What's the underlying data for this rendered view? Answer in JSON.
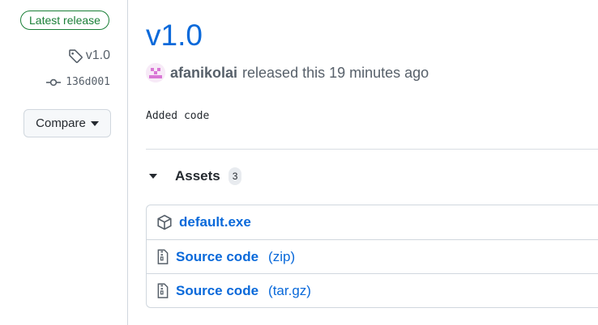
{
  "sidebar": {
    "latest_label": "Latest release",
    "tag_label": "v1.0",
    "commit_sha": "136d001",
    "compare_label": "Compare"
  },
  "release": {
    "title": "v1.0",
    "author": "afanikolai",
    "released_text": "released this 19 minutes ago",
    "notes": "Added code"
  },
  "assets": {
    "title": "Assets",
    "count": "3",
    "items": [
      {
        "name": "default.exe",
        "ext": "",
        "icon": "package-icon"
      },
      {
        "name": "Source code",
        "ext": "(zip)",
        "icon": "file-zip-icon"
      },
      {
        "name": "Source code",
        "ext": "(tar.gz)",
        "icon": "file-zip-icon"
      }
    ]
  },
  "colors": {
    "link": "#0969da",
    "success": "#1a7f37",
    "muted": "#57606a",
    "border": "#d0d7de"
  }
}
